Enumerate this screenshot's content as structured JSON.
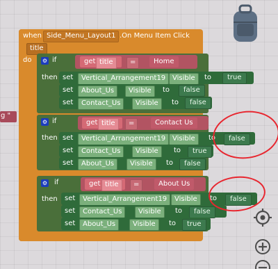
{
  "event": {
    "when": "when",
    "component": "Side_Menu_Layout1",
    "event_name": ".On Menu Item Click",
    "param": "title",
    "do": "do"
  },
  "left_text": "g \"",
  "blocks": [
    {
      "if": "if",
      "then": "then",
      "get": "get",
      "var": "title",
      "op": "=",
      "compare_text": "Home",
      "sets": [
        {
          "set": "set",
          "component": "Vertical_Arrangement19",
          "prop": "Visible",
          "to": "to",
          "value": "true"
        },
        {
          "set": "set",
          "component": "About_Us",
          "prop": "Visible",
          "to": "to",
          "value": "false"
        },
        {
          "set": "set",
          "component": "Contact_Us",
          "prop": "Visible",
          "to": "to",
          "value": "false"
        }
      ]
    },
    {
      "if": "if",
      "then": "then",
      "get": "get",
      "var": "title",
      "op": "=",
      "compare_text": "Contact Us",
      "sets": [
        {
          "set": "set",
          "component": "Vertical_Arrangement19",
          "prop": "Visible",
          "to": "to",
          "value": "false"
        },
        {
          "set": "set",
          "component": "Contact_Us",
          "prop": "Visible",
          "to": "to",
          "value": "true"
        },
        {
          "set": "set",
          "component": "About_Us",
          "prop": "Visible",
          "to": "to",
          "value": "false"
        }
      ]
    },
    {
      "if": "if",
      "then": "then",
      "get": "get",
      "var": "title",
      "op": "=",
      "compare_text": "About Us",
      "sets": [
        {
          "set": "set",
          "component": "Vertical_Arrangement19",
          "prop": "Visible",
          "to": "to",
          "value": "false"
        },
        {
          "set": "set",
          "component": "Contact_Us",
          "prop": "Visible",
          "to": "to",
          "value": "false"
        },
        {
          "set": "set",
          "component": "About_Us",
          "prop": "Visible",
          "to": "to",
          "value": "true"
        }
      ]
    }
  ],
  "icons": {
    "backpack": "backpack-icon",
    "target": "target-icon",
    "plus": "zoom-in-icon",
    "minus": "zoom-out-icon"
  },
  "colors": {
    "event_block": "#d98a2c",
    "set_block": "#2f6b3a",
    "text_block": "#a84a5a",
    "annotation": "#e8262f"
  }
}
